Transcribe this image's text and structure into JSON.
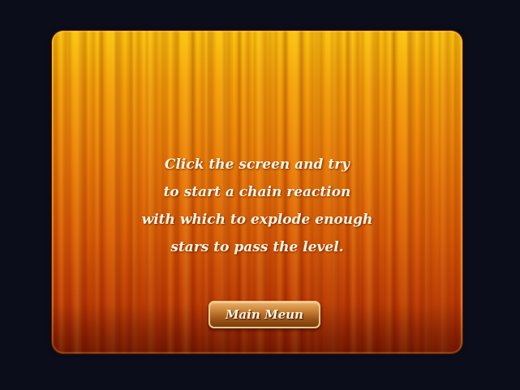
{
  "instructions": {
    "lines": [
      "Click the screen and try",
      "to start a chain reaction",
      "with which to explode enough",
      "stars to pass the level."
    ]
  },
  "menu_button": {
    "label": "Main Meun"
  },
  "colors": {
    "background": "#0c0d1b",
    "panel_top": "#fcc60c",
    "panel_bottom": "#8a1e02",
    "text": "#fff6e6",
    "button_border": "#f3c98a"
  }
}
